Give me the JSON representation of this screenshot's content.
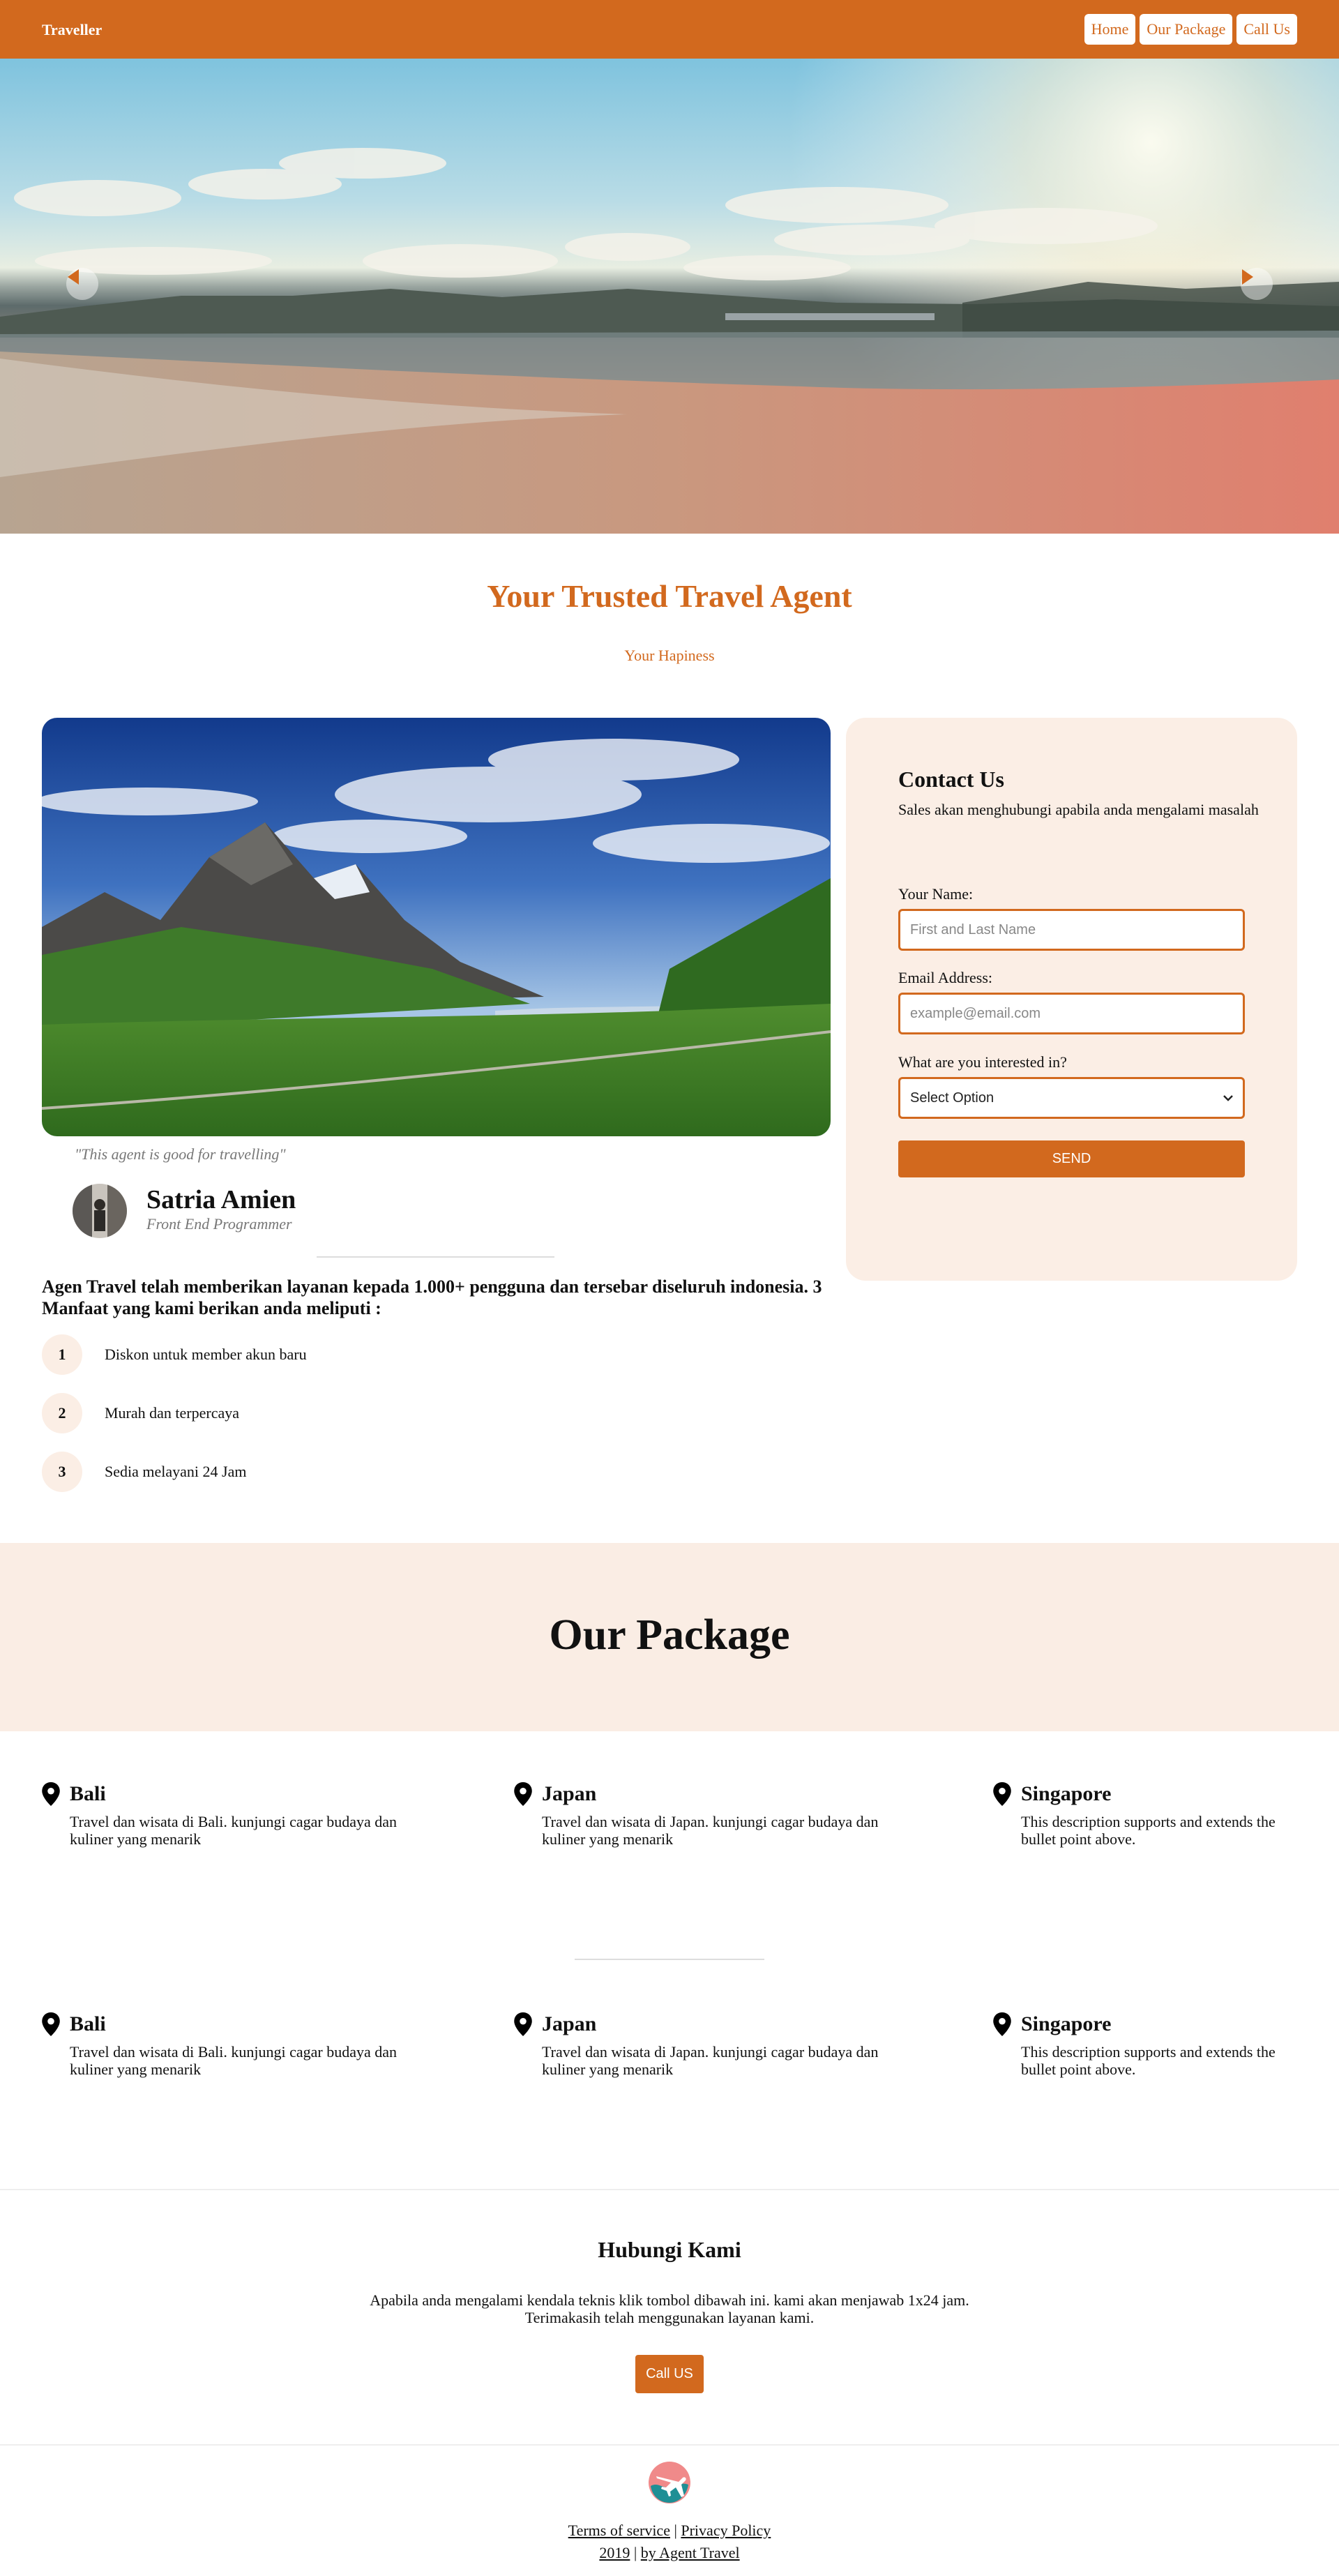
{
  "nav": {
    "brand": "Traveller",
    "links": [
      "Home",
      "Our Package",
      "Call Us"
    ]
  },
  "hero": {
    "prev_icon": "chevron-left-icon",
    "next_icon": "chevron-right-icon"
  },
  "intro": {
    "title": "Your Trusted Travel Agent",
    "subtitle": "Your Hapiness"
  },
  "testimonial": {
    "quote": "\"This agent is good for travelling\"",
    "name": "Satria Amien",
    "role": "Front End Programmer"
  },
  "benefits": {
    "intro": "Agen Travel telah memberikan layanan kepada 1.000+ pengguna dan tersebar diseluruh indonesia. 3 Manfaat yang kami berikan anda meliputi :",
    "items": [
      {
        "num": "1",
        "label": "Diskon untuk member akun baru"
      },
      {
        "num": "2",
        "label": "Murah dan terpercaya"
      },
      {
        "num": "3",
        "label": "Sedia melayani 24 Jam"
      }
    ]
  },
  "contact": {
    "title": "Contact Us",
    "description": "Sales akan menghubungi apabila anda mengalami masalah",
    "name_label": "Your Name:",
    "name_placeholder": "First and Last Name",
    "email_label": "Email Address:",
    "email_placeholder": "example@email.com",
    "interest_label": "What are you interested in?",
    "interest_selected": "Select Option",
    "send_label": "SEND"
  },
  "packages": {
    "title": "Our Package",
    "row1": [
      {
        "name": "Bali",
        "desc": "Travel dan wisata di Bali. kunjungi cagar budaya dan kuliner yang menarik"
      },
      {
        "name": "Japan",
        "desc": "Travel dan wisata di Japan. kunjungi cagar budaya dan kuliner yang menarik"
      },
      {
        "name": "Singapore",
        "desc": "This description supports and extends the bullet point above."
      }
    ],
    "row2": [
      {
        "name": "Bali",
        "desc": "Travel dan wisata di Bali. kunjungi cagar budaya dan kuliner yang menarik"
      },
      {
        "name": "Japan",
        "desc": "Travel dan wisata di Japan. kunjungi cagar budaya dan kuliner yang menarik"
      },
      {
        "name": "Singapore",
        "desc": "This description supports and extends the bullet point above."
      }
    ]
  },
  "hubungi": {
    "title": "Hubungi Kami",
    "line1": "Apabila anda mengalami kendala teknis klik tombol dibawah ini. kami akan menjawab 1x24 jam.",
    "line2": "Terimakasih telah menggunakan layanan kami.",
    "button": "Call US"
  },
  "footer": {
    "terms": "Terms of service",
    "sep": "|",
    "privacy": "Privacy Policy",
    "year": "2019",
    "by": "by Agent Travel"
  },
  "colors": {
    "accent": "#d2691e",
    "card_bg": "#fbeee5",
    "band_bg": "#faede4"
  }
}
